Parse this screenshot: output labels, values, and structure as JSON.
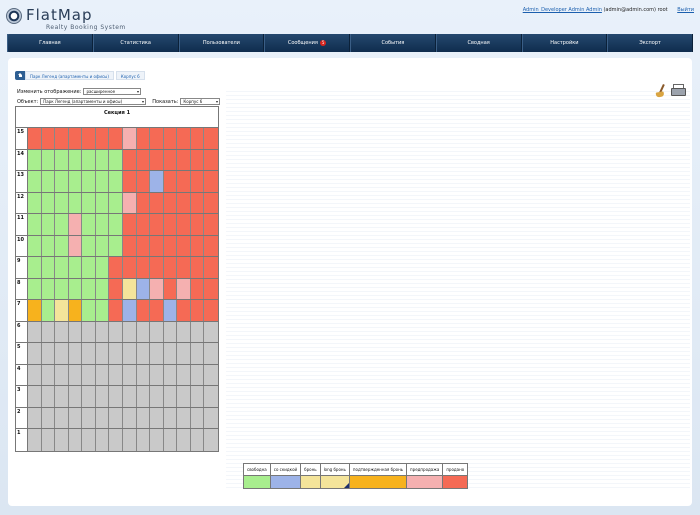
{
  "header": {
    "logo_name": "FlatMap",
    "logo_sub": "Realty Booking System",
    "user_link": "Admin_Developer Admin Admin",
    "user_email": "(admin@admin.com) root",
    "logout": "Выйти"
  },
  "nav": {
    "items": [
      {
        "label": "Главная"
      },
      {
        "label": "Статистика"
      },
      {
        "label": "Пользователи"
      },
      {
        "label": "Сообщения",
        "badge": "5"
      },
      {
        "label": "События"
      },
      {
        "label": "Сводная"
      },
      {
        "label": "Настройки"
      },
      {
        "label": "Экспорт"
      }
    ]
  },
  "breadcrumb": {
    "items": [
      "Парк Легенд (апартаменты и офисы)",
      "Корпус 6"
    ]
  },
  "controls": {
    "view_label": "Изменить отображение:",
    "view_value": "расширенное",
    "object_label": "Объект:",
    "object_value": "Парк Легенд (апартаменты и офисы)",
    "show_label": "Показать:",
    "show_value": "Корпус 6"
  },
  "section": {
    "title": "Секция 1"
  },
  "floors": [
    {
      "num": "15",
      "cells": [
        "sold",
        "sold",
        "sold",
        "sold",
        "sold",
        "sold",
        "sold",
        "pre",
        "sold",
        "sold",
        "sold",
        "sold",
        "sold",
        "sold"
      ]
    },
    {
      "num": "14",
      "cells": [
        "free",
        "free",
        "free",
        "free",
        "free",
        "free",
        "free",
        "sold",
        "sold",
        "sold",
        "sold",
        "sold",
        "sold",
        "sold"
      ]
    },
    {
      "num": "13",
      "cells": [
        "free",
        "free",
        "free",
        "free",
        "free",
        "free",
        "free",
        "sold",
        "sold",
        "disc",
        "sold",
        "sold",
        "sold",
        "sold"
      ]
    },
    {
      "num": "12",
      "cells": [
        "free",
        "free",
        "free",
        "free",
        "free",
        "free",
        "free",
        "pre",
        "sold",
        "sold",
        "sold",
        "sold",
        "sold",
        "sold"
      ]
    },
    {
      "num": "11",
      "cells": [
        "free",
        "free",
        "free",
        "pre",
        "free",
        "free",
        "free",
        "sold",
        "sold",
        "sold",
        "sold",
        "sold",
        "sold",
        "sold"
      ]
    },
    {
      "num": "10",
      "cells": [
        "free",
        "free",
        "free",
        "pre",
        "free",
        "free",
        "free",
        "sold",
        "sold",
        "sold",
        "sold",
        "sold",
        "sold",
        "sold"
      ]
    },
    {
      "num": "9",
      "cells": [
        "free",
        "free",
        "free",
        "free",
        "free",
        "free",
        "sold",
        "sold",
        "sold",
        "sold",
        "sold",
        "sold",
        "sold",
        "sold"
      ]
    },
    {
      "num": "8",
      "cells": [
        "free",
        "free",
        "free",
        "free",
        "free",
        "free",
        "sold",
        "book",
        "disc",
        "pre",
        "sold",
        "pre",
        "sold",
        "sold"
      ]
    },
    {
      "num": "7",
      "cells": [
        "conf",
        "free",
        "book",
        "conf",
        "free",
        "free",
        "sold",
        "disc",
        "sold",
        "sold",
        "disc",
        "sold",
        "sold",
        "sold"
      ]
    },
    {
      "num": "6",
      "cells": []
    },
    {
      "num": "5",
      "cells": []
    },
    {
      "num": "4",
      "cells": []
    },
    {
      "num": "3",
      "cells": []
    },
    {
      "num": "2",
      "cells": []
    },
    {
      "num": "1",
      "cells": []
    }
  ],
  "legend": [
    {
      "label": "свободна",
      "key": "free",
      "color": "#a8ee8e"
    },
    {
      "label": "со скидкой",
      "key": "disc",
      "color": "#9db3e8"
    },
    {
      "label": "бронь",
      "key": "book",
      "color": "#f4e49a"
    },
    {
      "label": "long бронь",
      "key": "lbook",
      "color": "#f4e49a"
    },
    {
      "label": "подтвержденная бронь",
      "key": "conf",
      "color": "#f7b21d"
    },
    {
      "label": "предпродажа",
      "key": "pre",
      "color": "#f5b0b0"
    },
    {
      "label": "продано",
      "key": "sold",
      "color": "#f56a55"
    }
  ]
}
